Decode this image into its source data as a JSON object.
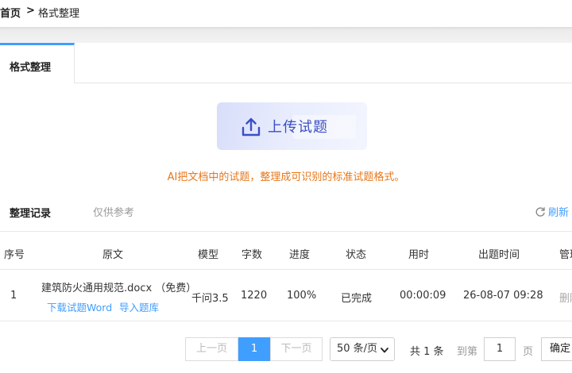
{
  "breadcrumb": {
    "home": "首页",
    "separator": ">",
    "current": "格式整理"
  },
  "tabs": [
    {
      "label": "格式整理",
      "active": true
    }
  ],
  "upload": {
    "label": "上传试题",
    "icon": "upload-icon",
    "color": "#3b4fc4"
  },
  "hint": "AI把文档中的试题，整理成可识别的标准试题格式。",
  "records": {
    "title": "整理记录",
    "subtitle": "仅供参考",
    "refresh_label": "刷新",
    "columns": [
      "序号",
      "原文",
      "模型",
      "字数",
      "进度",
      "状态",
      "用时",
      "出题时间",
      "管理"
    ],
    "rows": [
      {
        "index": "1",
        "filename": "建筑防火通用规范.docx （免费）",
        "download_link": "下载试题Word",
        "import_link": "导入题库",
        "model": "千问3.5",
        "words": "1220",
        "progress": "100%",
        "status": "已完成",
        "duration": "00:00:09",
        "created": "26-08-07 09:28",
        "manage": "删除"
      }
    ]
  },
  "pagination": {
    "prev": "上一页",
    "current_page": "1",
    "next": "下一页",
    "page_size": "50 条/页",
    "total": "共 1 条",
    "goto_label": "到第",
    "goto_value": "1",
    "page_unit": "页",
    "confirm": "确定"
  },
  "colors": {
    "accent": "#409eff",
    "hint": "#e8771a"
  }
}
